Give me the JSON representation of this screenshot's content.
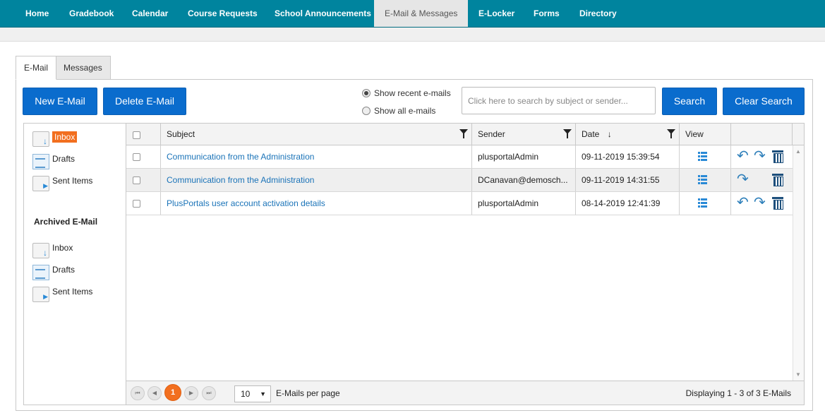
{
  "topnav": {
    "items": [
      "Home",
      "Gradebook",
      "Calendar",
      "Course Requests",
      "School Announcements",
      "E-Mail & Messages",
      "E-Locker",
      "Forms",
      "Directory"
    ],
    "active": "E-Mail & Messages"
  },
  "tabs": [
    "E-Mail",
    "Messages"
  ],
  "toolbar": {
    "new_label": "New E-Mail",
    "delete_label": "Delete E-Mail",
    "radio_recent": "Show recent e-mails",
    "radio_all": "Show all e-mails",
    "radio_selected": "recent",
    "search_placeholder": "Click here to search by subject or sender...",
    "search_label": "Search",
    "clear_label": "Clear Search"
  },
  "folders": {
    "main": [
      "Inbox",
      "Drafts",
      "Sent Items"
    ],
    "active": "Inbox",
    "archived_title": "Archived E-Mail",
    "archived": [
      "Inbox",
      "Drafts",
      "Sent Items"
    ]
  },
  "grid": {
    "headers": {
      "subject": "Subject",
      "sender": "Sender",
      "date": "Date",
      "sort_arrow": "↓",
      "view": "View"
    },
    "rows": [
      {
        "subject": "Communication from the Administration",
        "sender": "plusportalAdmin",
        "date": "09-11-2019 15:39:54",
        "actions": [
          "reply",
          "forward",
          "delete"
        ]
      },
      {
        "subject": "Communication from the Administration",
        "sender": "DCanavan@demosch...",
        "date": "09-11-2019 14:31:55",
        "actions": [
          "forward",
          "delete"
        ]
      },
      {
        "subject": "PlusPortals user account activation details",
        "sender": "plusportalAdmin",
        "date": "08-14-2019 12:41:39",
        "actions": [
          "reply",
          "forward",
          "delete"
        ]
      }
    ]
  },
  "pager": {
    "current_page": "1",
    "page_size": "10",
    "per_page_label": "E-Mails per page",
    "summary": "Displaying 1 - 3 of 3 E-Mails"
  },
  "icons": {
    "first": "⏮",
    "prev": "◀",
    "next": "▶",
    "last": "⏭",
    "reply": "↶",
    "forward": "↷",
    "caret": "▼"
  },
  "colors": {
    "nav": "#00849e",
    "button": "#0a6ccd",
    "accent": "#f26f1f",
    "link": "#1a73b8"
  }
}
